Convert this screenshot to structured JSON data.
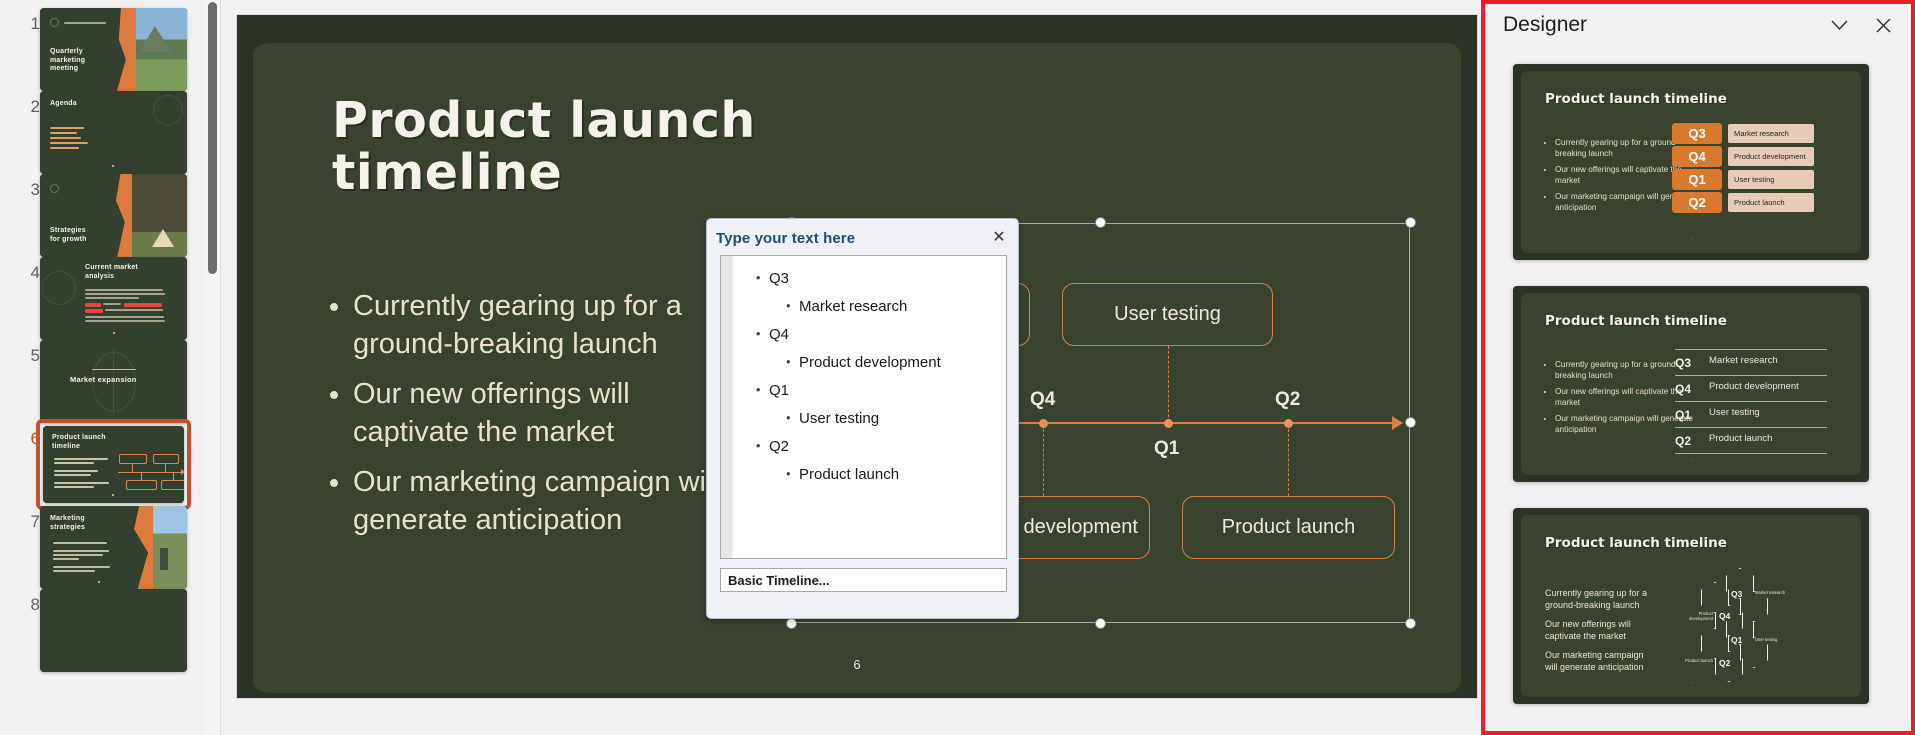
{
  "app": {
    "slide_number_display": "6"
  },
  "thumbnails": {
    "items": [
      {
        "number": "1",
        "title": "Quarterly marketing meeting",
        "layout": "photo-right-torn"
      },
      {
        "number": "2",
        "title": "Agenda",
        "layout": "agenda-list"
      },
      {
        "number": "3",
        "title": "Strategies for growth",
        "layout": "photo-right-torn"
      },
      {
        "number": "4",
        "title": "Current market analysis",
        "layout": "text-block-highlight"
      },
      {
        "number": "5",
        "title": "Market expansion",
        "layout": "section-divider"
      },
      {
        "number": "6",
        "title": "Product launch timeline",
        "layout": "timeline-smartart",
        "selected": true
      },
      {
        "number": "7",
        "title": "Marketing strategies",
        "layout": "photo-right-torn"
      },
      {
        "number": "8",
        "title": "",
        "layout": "partial"
      }
    ]
  },
  "slide": {
    "title": "Product launch timeline",
    "bullets": [
      "Currently gearing up for a ground-breaking launch",
      "Our new offerings will captivate the market",
      "Our marketing campaign will generate anticipation"
    ],
    "page_number": "6",
    "smartart": {
      "name": "Basic Timeline",
      "nodes": [
        {
          "label": "Market research",
          "quarter": "Q3",
          "position": "above"
        },
        {
          "label": "Product development",
          "quarter": "Q4",
          "position": "below"
        },
        {
          "label": "User testing",
          "quarter": "Q1",
          "position": "above"
        },
        {
          "label": "Product launch",
          "quarter": "Q2",
          "position": "below"
        }
      ],
      "axis_quarters_above": [
        "Q4",
        "Q2"
      ],
      "axis_quarters_below": [
        "Q3",
        "Q1"
      ],
      "accent_color": "#d4824c"
    }
  },
  "text_pane": {
    "title": "Type your text here",
    "close_icon": "close-icon",
    "caption": "Basic Timeline...",
    "entries": [
      {
        "level": 1,
        "text": "Q3"
      },
      {
        "level": 2,
        "text": "Market research"
      },
      {
        "level": 1,
        "text": "Q4"
      },
      {
        "level": 2,
        "text": "Product development"
      },
      {
        "level": 1,
        "text": "Q1"
      },
      {
        "level": 2,
        "text": " User testing"
      },
      {
        "level": 1,
        "text": "Q2"
      },
      {
        "level": 2,
        "text": "Product launch"
      }
    ]
  },
  "designer": {
    "title": "Designer",
    "collapse_icon": "chevron-down-icon",
    "close_icon": "close-icon",
    "highlight_color": "#ee1c25",
    "options": [
      {
        "id": "design-option-1",
        "style": "orange-chip-list",
        "title": "Product launch timeline",
        "bullets": [
          "Currently gearing up for a ground-breaking launch",
          "Our new offerings will captivate the market",
          "Our marketing campaign will generate anticipation"
        ],
        "rows": [
          {
            "quarter": "Q3",
            "text": "Market research"
          },
          {
            "quarter": "Q4",
            "text": "Product development"
          },
          {
            "quarter": "Q1",
            "text": " User testing"
          },
          {
            "quarter": "Q2",
            "text": "Product launch"
          }
        ],
        "chip_color": "#d9792f",
        "label_color": "#e7cbb8"
      },
      {
        "id": "design-option-2",
        "style": "underlined-rows",
        "title": "Product launch timeline",
        "bullets": [
          "Currently gearing up for a ground-breaking launch",
          "Our new offerings will captivate the market",
          "Our marketing campaign will generate anticipation"
        ],
        "rows": [
          {
            "quarter": "Q3",
            "text": "Market research"
          },
          {
            "quarter": "Q4",
            "text": "Product development"
          },
          {
            "quarter": "Q1",
            "text": " User testing"
          },
          {
            "quarter": "Q2",
            "text": "Product launch"
          }
        ]
      },
      {
        "id": "design-option-3",
        "style": "hexagon-cluster",
        "title": "Product launch timeline",
        "bullets": [
          "Currently gearing up for a ground-breaking launch",
          "Our new offerings will captivate the market",
          "Our marketing campaign will generate anticipation"
        ],
        "rows": [
          {
            "quarter": "Q3",
            "text": "Market research"
          },
          {
            "quarter": "Q4",
            "text": "Product development"
          },
          {
            "quarter": "Q1",
            "text": "User testing"
          },
          {
            "quarter": "Q2",
            "text": "Product launch"
          }
        ]
      }
    ]
  },
  "navigation": {
    "caret_icon": "caret-down-icon",
    "previous_slide_icon": "previous-slide-icon",
    "next_slide_icon": "next-slide-icon"
  },
  "theme": {
    "slide_bg": "#2c3327",
    "slide_panel": "#39432f",
    "accent_orange": "#d4824c",
    "text_cream": "#e8e1cd"
  }
}
